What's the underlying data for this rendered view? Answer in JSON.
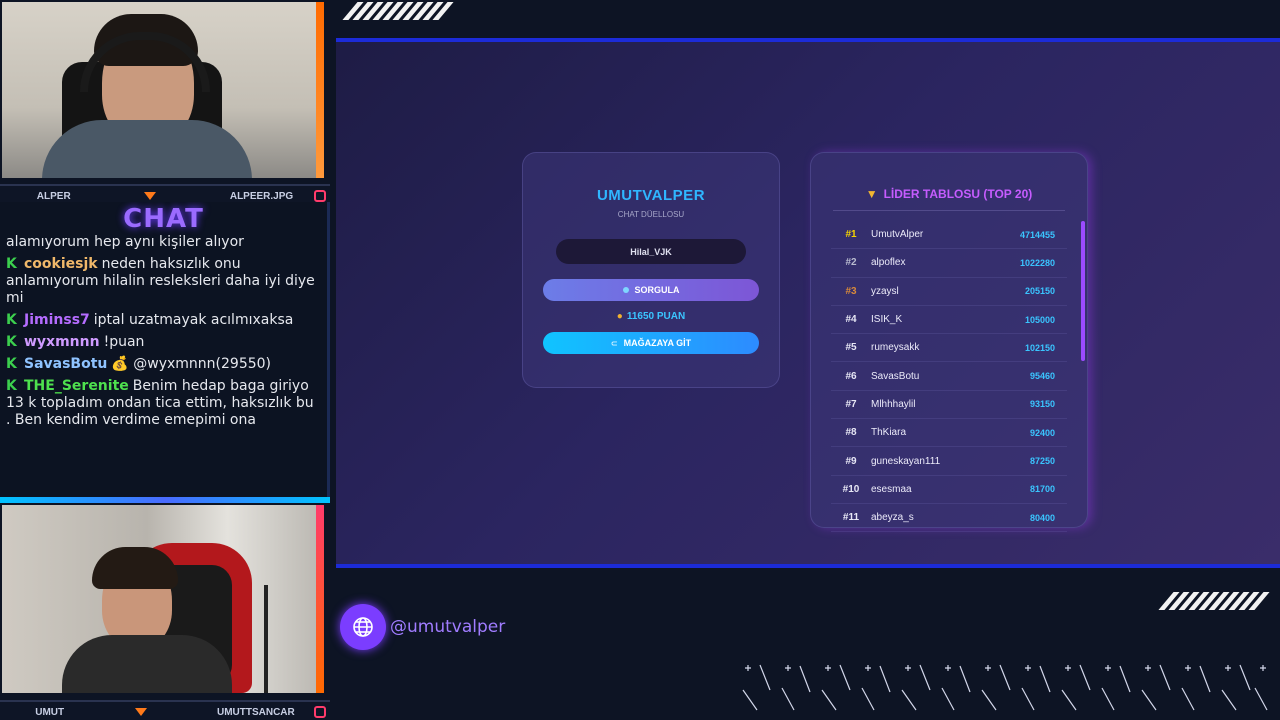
{
  "webcam_top": {
    "name_left": "ALPER",
    "name_right": "ALPEER.JPG"
  },
  "webcam_bottom": {
    "name_left": "UMUT",
    "name_right": "UMUTTSANCAR"
  },
  "chat": {
    "title": "CHAT",
    "messages": [
      {
        "user": "",
        "text": "alamıyorum hep aynı kişiler alıyor",
        "user_color": ""
      },
      {
        "user": "cookiesjk",
        "text": "neden haksızlık onu anlamıyorum hilalin resleksleri daha iyi diye mi",
        "user_color": "#f0b86a"
      },
      {
        "user": "Jiminss7",
        "text": "iptal uzatmayak acılmıxaksa",
        "user_color": "#b56cff"
      },
      {
        "user": "wyxmnnn",
        "text": "!puan",
        "user_color": "#cf9bff"
      },
      {
        "user": "SavasBotu",
        "text": "💰 @wyxmnnn(29550)",
        "user_color": "#8fc3ff"
      },
      {
        "user": "THE_Serenite",
        "text": "Benim hedap baga giriyo 13 k topladım ondan tica ettim, haksızlık bu . Ben kendim verdime emepimi ona",
        "user_color": "#4ee04e"
      }
    ]
  },
  "duel_card": {
    "title": "UMUTVALPER",
    "subtitle": "CHAT DÜELLOSU",
    "input_value": "Hilal_VJK",
    "query_button": "SORGULA",
    "points": "11650 PUAN",
    "store_button": "MAĞAZAYA GİT"
  },
  "leaderboard": {
    "title": "LİDER TABLOSU (TOP 20)",
    "rows": [
      {
        "rank": "#1",
        "name": "UmutvAlper",
        "score": "4714455",
        "rank_color": "#f5d300"
      },
      {
        "rank": "#2",
        "name": "alpoflex",
        "score": "1022280",
        "rank_color": "#b9bcd0"
      },
      {
        "rank": "#3",
        "name": "yzaysl",
        "score": "205150",
        "rank_color": "#d98a3a"
      },
      {
        "rank": "#4",
        "name": "ISIK_K",
        "score": "105000",
        "rank_color": "#e8e8f6"
      },
      {
        "rank": "#5",
        "name": "rumeysakk",
        "score": "102150",
        "rank_color": "#e8e8f6"
      },
      {
        "rank": "#6",
        "name": "SavasBotu",
        "score": "95460",
        "rank_color": "#e8e8f6"
      },
      {
        "rank": "#7",
        "name": "Mlhhhaylil",
        "score": "93150",
        "rank_color": "#e8e8f6"
      },
      {
        "rank": "#8",
        "name": "ThKiara",
        "score": "92400",
        "rank_color": "#e8e8f6"
      },
      {
        "rank": "#9",
        "name": "guneskayan111",
        "score": "87250",
        "rank_color": "#e8e8f6"
      },
      {
        "rank": "#10",
        "name": "esesmaa",
        "score": "81700",
        "rank_color": "#e8e8f6"
      },
      {
        "rank": "#11",
        "name": "abeyza_s",
        "score": "80400",
        "rank_color": "#e8e8f6"
      }
    ]
  },
  "social": {
    "handle": "@umutvalper",
    "icon": "globe-icon"
  }
}
